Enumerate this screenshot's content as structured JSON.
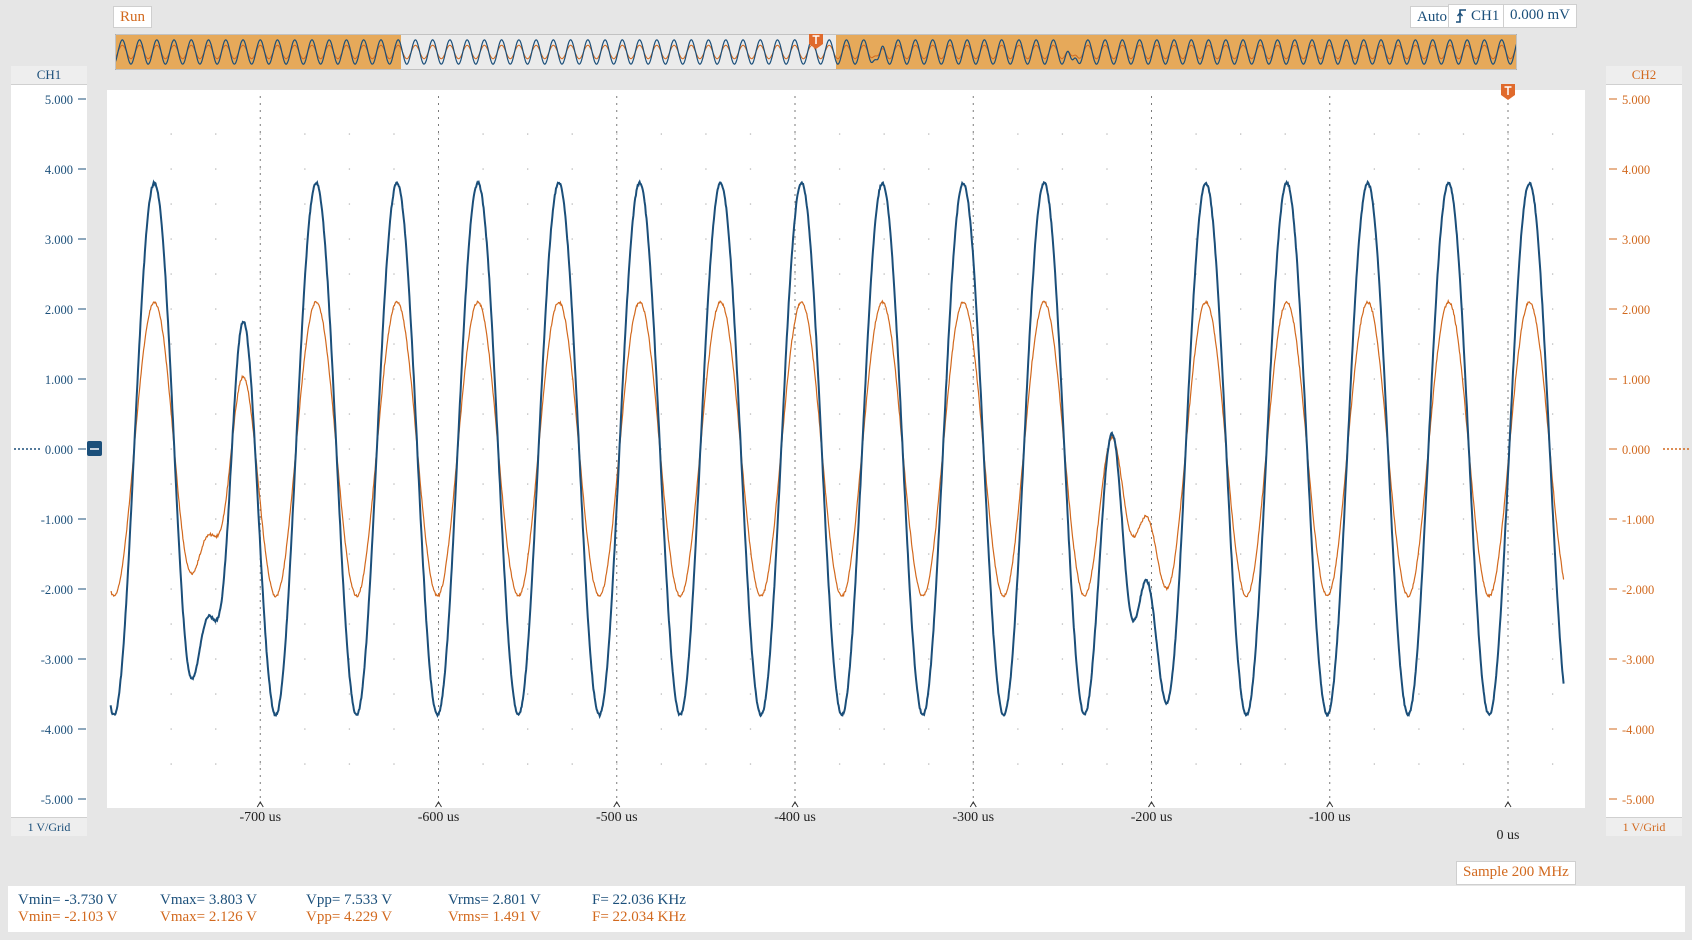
{
  "header": {
    "run_label": "Run",
    "trigger_mode": "Auto",
    "trigger_edge_icon": "rising-edge-icon",
    "trigger_source": "CH1",
    "trigger_level": "0.000 mV"
  },
  "colors": {
    "ch1": "#1b4f7a",
    "ch2": "#d2691e",
    "window": "#e6a95a"
  },
  "ch1_panel": {
    "title": "CH1",
    "scale": "1 V/Grid",
    "ticks": [
      "5.000",
      "4.000",
      "3.000",
      "2.000",
      "1.000",
      "0.000",
      "-1.000",
      "-2.000",
      "-3.000",
      "-4.000",
      "-5.000"
    ]
  },
  "ch2_panel": {
    "title": "CH2",
    "scale": "1 V/Grid",
    "ticks": [
      "5.000",
      "4.000",
      "3.000",
      "2.000",
      "1.000",
      "0.000",
      "-1.000",
      "-2.000",
      "-3.000",
      "-4.000",
      "-5.000"
    ]
  },
  "time_axis": {
    "ticks": [
      "-700 us",
      "-600 us",
      "-500 us",
      "-400 us",
      "-300 us",
      "-200 us",
      "-100 us"
    ],
    "trigger_label": "0 us"
  },
  "sample_rate": "Sample 200 MHz",
  "measurements": {
    "ch1": {
      "vmin": "Vmin= -3.730 V",
      "vmax": "Vmax= 3.803 V",
      "vpp": "Vpp= 7.533 V",
      "vrms": "Vrms= 2.801 V",
      "freq": "F= 22.036 KHz"
    },
    "ch2": {
      "vmin": "Vmin= -2.103 V",
      "vmax": "Vmax= 2.126 V",
      "vpp": "Vpp= 4.229 V",
      "vrms": "Vrms= 1.491 V",
      "freq": "F= 22.034 KHz"
    }
  },
  "chart_data": {
    "type": "line",
    "x_unit": "us",
    "xlim": [
      -775,
      35
    ],
    "ylim": [
      -5,
      5
    ],
    "y_unit": "V",
    "grid": true,
    "frequency_khz": 22.036,
    "series": [
      {
        "name": "CH1",
        "amplitude_v": 3.8,
        "dips_at_us": [
          -725,
          -210
        ],
        "dip_peak_v": -2.45
      },
      {
        "name": "CH2",
        "amplitude_v": 2.1,
        "dips_at_us": [
          -725,
          -210
        ],
        "dip_peak_v": -1.25
      }
    ]
  }
}
